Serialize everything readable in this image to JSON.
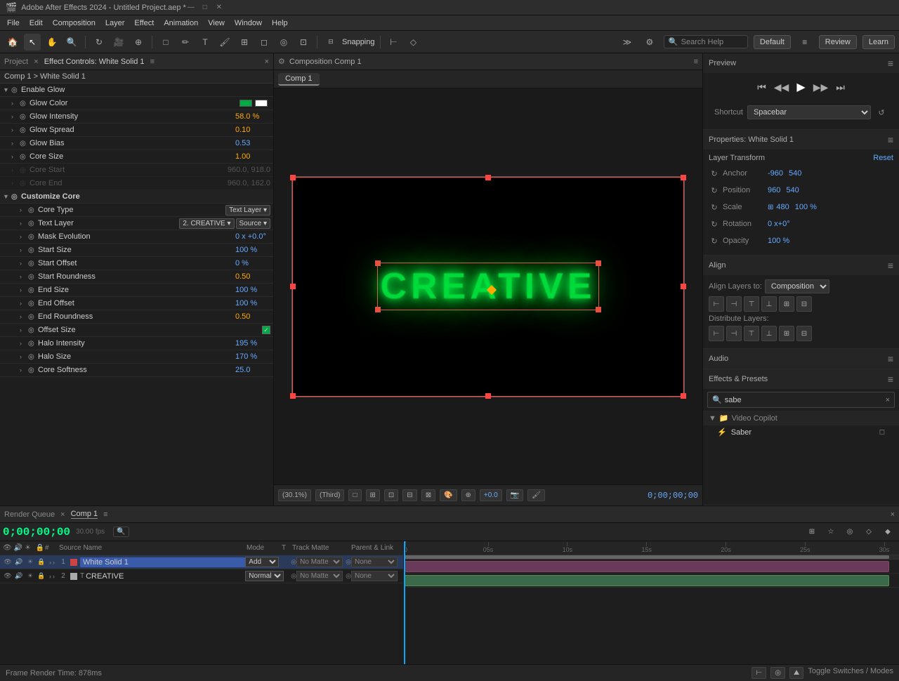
{
  "titlebar": {
    "title": "Adobe After Effects 2024 - Untitled Project.aep *",
    "min": "—",
    "max": "□",
    "close": "✕"
  },
  "menubar": {
    "items": [
      "File",
      "Edit",
      "Composition",
      "Layer",
      "Effect",
      "Animation",
      "View",
      "Window",
      "Help"
    ]
  },
  "toolbar": {
    "snapping_label": "Snapping",
    "default_label": "Default",
    "review_label": "Review",
    "learn_label": "Learn",
    "search_placeholder": "Search Help"
  },
  "left_panel": {
    "tabs": [
      "Project",
      "Effect Controls: White Solid 1"
    ],
    "breadcrumb": "Comp 1 > White Solid 1",
    "effects": [
      {
        "indent": 0,
        "expand": true,
        "icon": "◎",
        "label": "Enable Glow",
        "value": "",
        "type": "toggle"
      },
      {
        "indent": 0,
        "expand": false,
        "icon": "◎",
        "label": "Glow Color",
        "value": "",
        "type": "color",
        "color": "#00aa44"
      },
      {
        "indent": 0,
        "expand": false,
        "icon": "◎",
        "label": "Glow Intensity",
        "value": "58.0 %",
        "type": "value"
      },
      {
        "indent": 0,
        "expand": false,
        "icon": "◎",
        "label": "Glow Spread",
        "value": "0.10",
        "type": "value"
      },
      {
        "indent": 0,
        "expand": false,
        "icon": "◎",
        "label": "Glow Bias",
        "value": "0.53",
        "type": "value"
      },
      {
        "indent": 0,
        "expand": false,
        "icon": "◎",
        "label": "Core Size",
        "value": "1.00",
        "type": "value"
      },
      {
        "indent": 0,
        "expand": false,
        "icon": "◎",
        "label": "Core Start",
        "value": "960.0, 918.0",
        "type": "value",
        "dimmed": true
      },
      {
        "indent": 0,
        "expand": false,
        "icon": "◎",
        "label": "Core End",
        "value": "960.0, 162.0",
        "type": "value",
        "dimmed": true
      },
      {
        "indent": 0,
        "expand": true,
        "icon": "◎",
        "label": "Customize Core",
        "value": "",
        "type": "group"
      },
      {
        "indent": 1,
        "expand": false,
        "icon": "◎",
        "label": "Core Type",
        "value": "Text Layer",
        "type": "dropdown"
      },
      {
        "indent": 1,
        "expand": false,
        "icon": "◎",
        "label": "Text Layer",
        "value": "2. CREATIVE",
        "type": "dropdown2"
      },
      {
        "indent": 1,
        "expand": false,
        "icon": "◎",
        "label": "Mask Evolution",
        "value": "0 x +0.0°",
        "type": "value"
      },
      {
        "indent": 1,
        "expand": false,
        "icon": "◎",
        "label": "Start Size",
        "value": "100 %",
        "type": "value"
      },
      {
        "indent": 1,
        "expand": false,
        "icon": "◎",
        "label": "Start Offset",
        "value": "0 %",
        "type": "value"
      },
      {
        "indent": 1,
        "expand": false,
        "icon": "◎",
        "label": "Start Roundness",
        "value": "0.50",
        "type": "value",
        "orange": true
      },
      {
        "indent": 1,
        "expand": false,
        "icon": "◎",
        "label": "End Size",
        "value": "100 %",
        "type": "value"
      },
      {
        "indent": 1,
        "expand": false,
        "icon": "◎",
        "label": "End Offset",
        "value": "100 %",
        "type": "value"
      },
      {
        "indent": 1,
        "expand": false,
        "icon": "◎",
        "label": "End Roundness",
        "value": "0.50",
        "type": "value",
        "orange": true
      },
      {
        "indent": 1,
        "expand": false,
        "icon": "◎",
        "label": "Offset Size",
        "value": "✓",
        "type": "checkbox"
      },
      {
        "indent": 1,
        "expand": false,
        "icon": "◎",
        "label": "Halo Intensity",
        "value": "195 %",
        "type": "value"
      },
      {
        "indent": 1,
        "expand": false,
        "icon": "◎",
        "label": "Halo Size",
        "value": "170 %",
        "type": "value"
      },
      {
        "indent": 1,
        "expand": false,
        "icon": "◎",
        "label": "Core Softness",
        "value": "25.0",
        "type": "value"
      }
    ]
  },
  "composition": {
    "tab_label": "Comp 1",
    "panel_title": "Composition Comp 1",
    "glow_text": "CREATIVE",
    "zoom_label": "(30.1%)",
    "view_label": "(Third)",
    "timecode": "0;00;00;00",
    "bottom_btns": [
      "□",
      "⊞",
      "⊡",
      "⊟",
      "⊠",
      "🎨",
      "⊕",
      "+0.0",
      "📷",
      "🖌"
    ]
  },
  "right_panel": {
    "preview_label": "Preview",
    "shortcut_label": "Shortcut",
    "shortcut_value": "Spacebar",
    "properties_label": "Properties: White Solid 1",
    "reset_label": "Reset",
    "layer_transform_label": "Layer Transform",
    "props": [
      {
        "icon": "↻",
        "label": "Anchor",
        "value": "-960   540"
      },
      {
        "icon": "↻",
        "label": "Position",
        "value": "960   540"
      },
      {
        "icon": "↻",
        "label": "Scale",
        "value": "⊞480   100 %"
      },
      {
        "icon": "↻",
        "label": "Rotation",
        "value": "0 x+0°"
      },
      {
        "icon": "↻",
        "label": "Opacity",
        "value": "100 %"
      }
    ],
    "align_label": "Align",
    "align_to_label": "Align Layers to:",
    "align_to_value": "Composition",
    "align_btns": [
      "⊢",
      "⊣",
      "⊤",
      "⊥",
      "⊞",
      "⊟"
    ],
    "distribute_label": "Distribute Layers:",
    "distribute_btns": [
      "⊞",
      "⊟",
      "⊠",
      "⊡",
      "⊢",
      "⊣"
    ],
    "audio_label": "Audio",
    "effects_presets_label": "Effects & Presets",
    "search_placeholder": "sabe",
    "video_copilot_label": "Video Copilot",
    "saber_label": "Saber"
  },
  "timeline": {
    "panel_label": "Render Queue",
    "comp_tab": "Comp 1",
    "timecode": "0;00;00;00",
    "fps_label": "30.00 fps",
    "search_placeholder": "Search",
    "col_headers": [
      "",
      "",
      "Source Name",
      "Mode",
      "T",
      "Track Matte",
      "",
      "Parent & Link"
    ],
    "layers": [
      {
        "num": "1",
        "color": "#cc4444",
        "type": "solid",
        "name": "White Solid 1",
        "mode": "Add",
        "track": "",
        "matte": "No Matte",
        "parent": "None",
        "selected": true
      },
      {
        "num": "2",
        "color": "#aaaaaa",
        "type": "text",
        "name": "CREATIVE",
        "mode": "Normal",
        "track": "",
        "matte": "No Matte",
        "parent": "None",
        "selected": false
      }
    ],
    "time_markers": [
      "05s",
      "10s",
      "15s",
      "20s",
      "25s",
      "30s"
    ],
    "frame_render_time": "Frame Render Time: 878ms",
    "toggle_label": "Toggle Switches / Modes"
  }
}
